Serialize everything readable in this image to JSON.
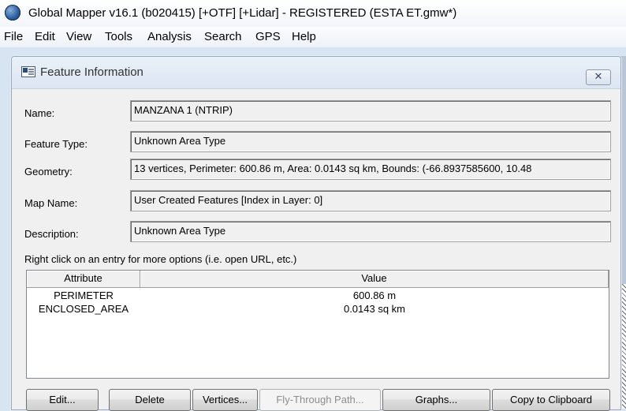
{
  "window": {
    "title": "Global Mapper v16.1 (b020415) [+OTF] [+Lidar] - REGISTERED (ESTA ET.gmw*)",
    "icon": "globe-icon"
  },
  "menu": [
    "File",
    "Edit",
    "View",
    "Tools",
    "Analysis",
    "Search",
    "GPS",
    "Help"
  ],
  "dialog": {
    "title": "Feature Information",
    "close_glyph": "✕",
    "fields": [
      {
        "label": "Name:",
        "value": "MANZANA 1 (NTRIP)"
      },
      {
        "label": "Feature Type:",
        "value": "Unknown Area Type"
      },
      {
        "label": "Geometry:",
        "value": "13 vertices, Perimeter: 600.86 m, Area: 0.0143 sq km, Bounds: (-66.8937585600, 10.48"
      },
      {
        "label": "Map Name:",
        "value": "User Created Features [Index in Layer: 0]"
      },
      {
        "label": "Description:",
        "value": "Unknown Area Type"
      }
    ],
    "hint": "Right click on an entry for more options (i.e. open URL, etc.)",
    "table": {
      "columns": [
        "Attribute",
        "Value"
      ],
      "rows": [
        {
          "attribute": "PERIMETER",
          "value": "600.86 m"
        },
        {
          "attribute": "ENCLOSED_AREA",
          "value": "0.0143 sq km"
        }
      ]
    },
    "buttons": {
      "edit": "Edit...",
      "delete": "Delete",
      "vertices": "Vertices...",
      "fly_through": "Fly-Through Path...",
      "graphs": "Graphs...",
      "copy": "Copy to Clipboard"
    }
  }
}
